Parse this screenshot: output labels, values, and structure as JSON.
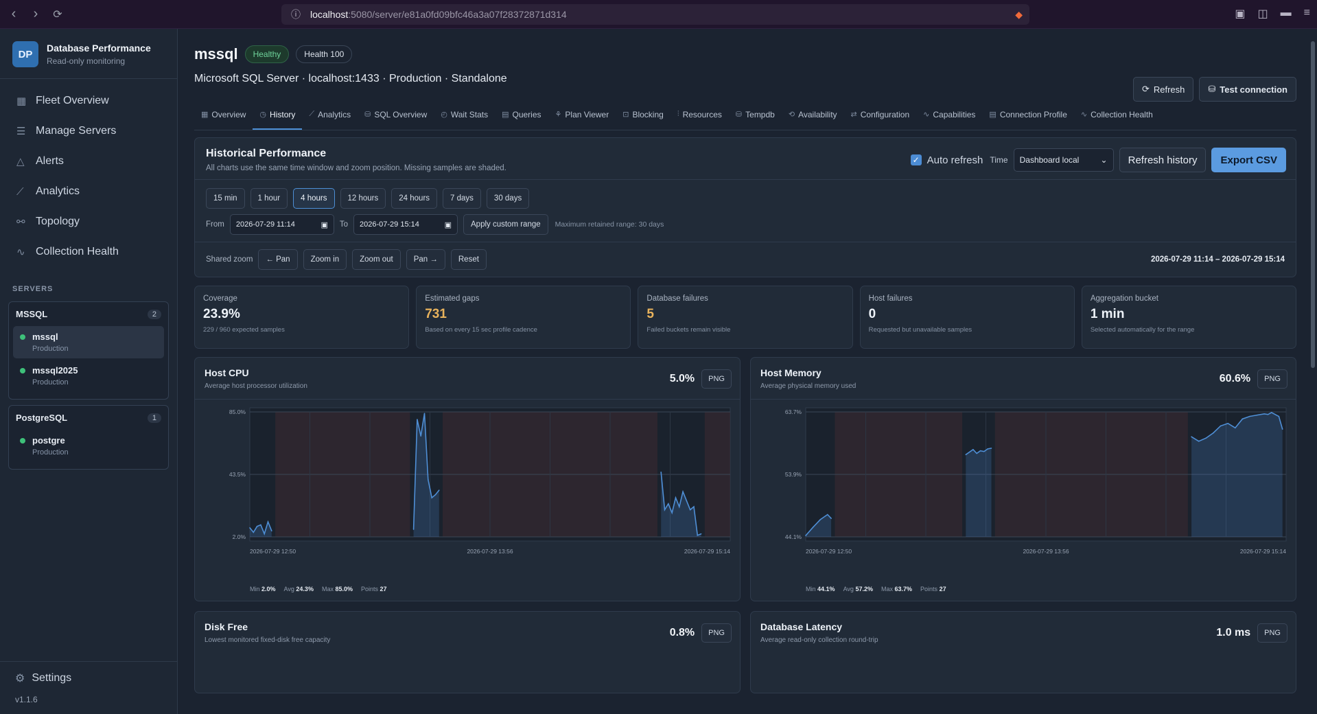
{
  "browser": {
    "url_host": "localhost",
    "url_path": ":5080/server/e81a0fd09bfc46a3a07f28372871d314"
  },
  "sidebar": {
    "brand_initials": "DP",
    "brand_title": "Database Performance",
    "brand_sub": "Read-only monitoring",
    "nav": [
      {
        "label": "Fleet Overview",
        "icon": "grid-icon"
      },
      {
        "label": "Manage Servers",
        "icon": "server-icon"
      },
      {
        "label": "Alerts",
        "icon": "warning-icon"
      },
      {
        "label": "Analytics",
        "icon": "chart-icon"
      },
      {
        "label": "Topology",
        "icon": "topology-icon"
      },
      {
        "label": "Collection Health",
        "icon": "pulse-icon"
      }
    ],
    "servers_label": "SERVERS",
    "groups": [
      {
        "name": "MSSQL",
        "count": "2",
        "servers": [
          {
            "name": "mssql",
            "env": "Production"
          },
          {
            "name": "mssql2025",
            "env": "Production"
          }
        ]
      },
      {
        "name": "PostgreSQL",
        "count": "1",
        "servers": [
          {
            "name": "postgre",
            "env": "Production"
          }
        ]
      }
    ],
    "settings": "Settings",
    "version": "v1.1.6"
  },
  "header": {
    "title": "mssql",
    "status": "Healthy",
    "health": "Health 100",
    "subtitle": "Microsoft SQL Server · localhost:1433 · Production · Standalone",
    "refresh": "Refresh",
    "test_connection": "Test connection"
  },
  "tabs": [
    "Overview",
    "History",
    "Analytics",
    "SQL Overview",
    "Wait Stats",
    "Queries",
    "Plan Viewer",
    "Blocking",
    "Resources",
    "Tempdb",
    "Availability",
    "Configuration",
    "Capabilities",
    "Connection Profile",
    "Collection Health"
  ],
  "history": {
    "title": "Historical Performance",
    "sub": "All charts use the same time window and zoom position. Missing samples are shaded.",
    "auto_refresh": "Auto refresh",
    "time_label": "Time",
    "timezone": "Dashboard local",
    "refresh_history": "Refresh history",
    "export": "Export CSV",
    "ranges": [
      "15 min",
      "1 hour",
      "4 hours",
      "12 hours",
      "24 hours",
      "7 days",
      "30 days"
    ],
    "active_range": "4 hours",
    "from_label": "From",
    "from": "2026-07-29 11:14",
    "to_label": "To",
    "to": "2026-07-29 15:14",
    "apply": "Apply custom range",
    "hint": "Maximum retained range: 30 days",
    "zoom_label": "Shared zoom",
    "zoom_btns": [
      "← Pan",
      "Zoom in",
      "Zoom out",
      "Pan →",
      "Reset"
    ],
    "window": "2026-07-29 11:14 – 2026-07-29 15:14"
  },
  "stats": [
    {
      "label": "Coverage",
      "value": "23.9%",
      "note": "229 / 960 expected samples"
    },
    {
      "label": "Estimated gaps",
      "value": "731",
      "note": "Based on every 15 sec profile cadence"
    },
    {
      "label": "Database failures",
      "value": "5",
      "note": "Failed buckets remain visible"
    },
    {
      "label": "Host failures",
      "value": "0",
      "note": "Requested but unavailable samples"
    },
    {
      "label": "Aggregation bucket",
      "value": "1 min",
      "note": "Selected automatically for the range"
    }
  ],
  "cards": [
    {
      "title": "Host CPU",
      "sub": "Average host processor utilization",
      "value": "5.0%",
      "png": "PNG",
      "min_label": "Min",
      "min": "2.0%",
      "avg_label": "Avg",
      "avg": "24.3%",
      "max_label": "Max",
      "max": "85.0%",
      "points_label": "Points",
      "points": "27"
    },
    {
      "title": "Host Memory",
      "sub": "Average physical memory used",
      "value": "60.6%",
      "png": "PNG",
      "min_label": "Min",
      "min": "44.1%",
      "avg_label": "Avg",
      "avg": "57.2%",
      "max_label": "Max",
      "max": "63.7%",
      "points_label": "Points",
      "points": "27"
    },
    {
      "title": "Disk Free",
      "sub": "Lowest monitored fixed-disk free capacity",
      "value": "0.8%",
      "png": "PNG"
    },
    {
      "title": "Database Latency",
      "sub": "Average read-only collection round-trip",
      "value": "1.0 ms",
      "png": "PNG"
    }
  ],
  "chart_data": [
    {
      "type": "line",
      "title": "Host CPU",
      "ylim": [
        2.0,
        85.0
      ],
      "yticks": [
        "85.0%",
        "43.5%",
        "2.0%"
      ],
      "xticks": [
        "2026-07-29 12:50",
        "2026-07-29 13:56",
        "2026-07-29 15:14"
      ],
      "x_minutes": [
        0,
        1,
        2,
        3,
        4,
        5,
        6,
        45,
        46,
        47,
        48,
        49,
        50,
        51,
        52,
        113,
        114,
        115,
        116,
        117,
        118,
        119,
        120,
        121,
        122,
        123,
        124
      ],
      "values": [
        8,
        5,
        9,
        10,
        4,
        12,
        6,
        7,
        80,
        69,
        84,
        40,
        28,
        30,
        33,
        45,
        20,
        24,
        18,
        28,
        22,
        32,
        26,
        20,
        22,
        3,
        4
      ],
      "color": "#4f8fd6",
      "gap_color": "#3a2a30"
    },
    {
      "type": "line",
      "title": "Host Memory",
      "ylim": [
        44.1,
        63.7
      ],
      "yticks": [
        "63.7%",
        "53.9%",
        "44.1%"
      ],
      "xticks": [
        "2026-07-29 12:50",
        "2026-07-29 13:56",
        "2026-07-29 15:14"
      ],
      "x_minutes": [
        0,
        2,
        4,
        6,
        7,
        44,
        46,
        47,
        48,
        49,
        50,
        51,
        106,
        108,
        110,
        112,
        114,
        116,
        118,
        120,
        122,
        124,
        126,
        127,
        128,
        130,
        131
      ],
      "values": [
        44.3,
        45.6,
        46.8,
        47.6,
        47.0,
        57.0,
        57.8,
        57.2,
        57.6,
        57.5,
        57.9,
        58.0,
        59.8,
        59.1,
        59.6,
        60.4,
        61.5,
        61.9,
        61.2,
        62.6,
        63.0,
        63.2,
        63.4,
        63.3,
        63.6,
        63.0,
        61.0
      ],
      "color": "#4f8fd6",
      "gap_color": "#3a2a30"
    }
  ]
}
